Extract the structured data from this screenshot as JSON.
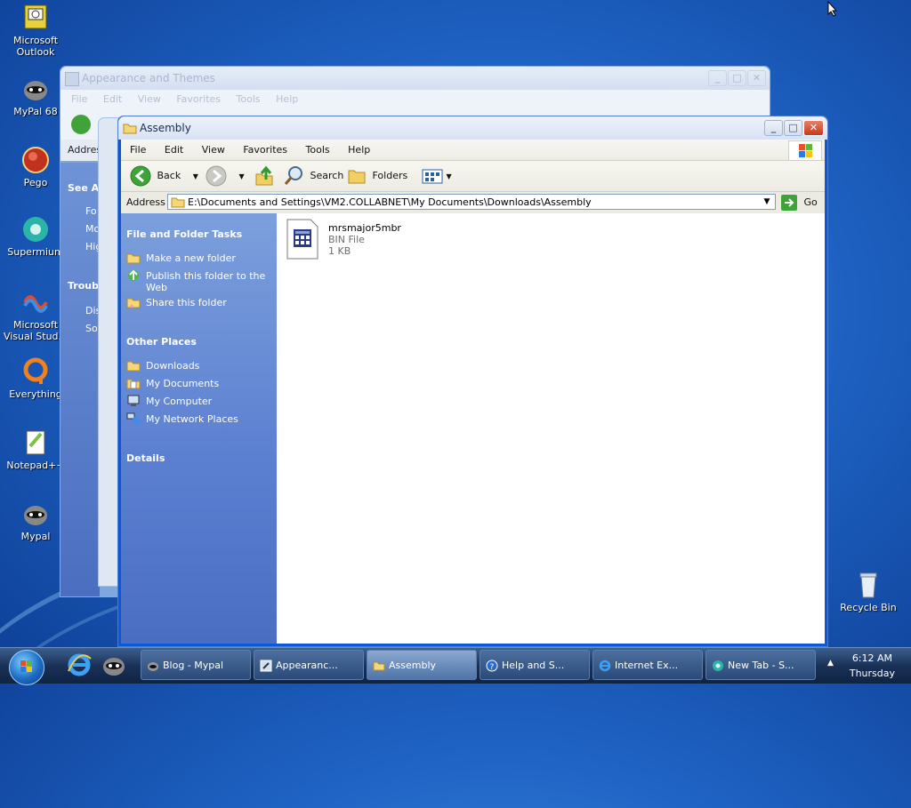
{
  "desktop": {
    "icons": [
      {
        "label": "Microsoft Outlook"
      },
      {
        "label": "MyPal 68"
      },
      {
        "label": "Pego"
      },
      {
        "label": "Supermium"
      },
      {
        "label": "Microsoft Visual Stud..."
      },
      {
        "label": "Everything"
      },
      {
        "label": "Notepad++"
      },
      {
        "label": "Mypal"
      },
      {
        "label": "Recycle Bin"
      }
    ]
  },
  "back_window": {
    "title": "Appearance and Themes",
    "menu": [
      "File",
      "Edit",
      "View",
      "Favorites",
      "Tools",
      "Help"
    ],
    "address_label": "Addres",
    "see_also": "See Als",
    "see_also_items": [
      "Fo",
      "Mo",
      "Hig"
    ],
    "troubleshoot": "Troubl",
    "troubleshoot_items": [
      "Dis",
      "So"
    ]
  },
  "main_window": {
    "title": "Assembly",
    "menu": [
      "File",
      "Edit",
      "View",
      "Favorites",
      "Tools",
      "Help"
    ],
    "toolbar": {
      "back": "Back",
      "search": "Search",
      "folders": "Folders"
    },
    "address": {
      "label": "Address",
      "value": "E:\\Documents and Settings\\VM2.COLLABNET\\My Documents\\Downloads\\Assembly",
      "go": "Go"
    },
    "tasks": {
      "file_folder_title": "File and Folder Tasks",
      "file_folder_items": [
        "Make a new folder",
        "Publish this folder to the Web",
        "Share this folder"
      ],
      "other_places_title": "Other Places",
      "other_places_items": [
        "Downloads",
        "My Documents",
        "My Computer",
        "My Network Places"
      ],
      "details_title": "Details"
    },
    "file": {
      "name": "mrsmajor5mbr",
      "type": "BIN File",
      "size": "1 KB"
    }
  },
  "taskbar": {
    "items": [
      {
        "label": "Blog - Mypal"
      },
      {
        "label": "Appearanc..."
      },
      {
        "label": "Assembly"
      },
      {
        "label": "Help and S..."
      },
      {
        "label": "Internet Ex..."
      },
      {
        "label": "New Tab - S..."
      }
    ],
    "clock": {
      "time": "6:12 AM",
      "day": "Thursday"
    }
  }
}
